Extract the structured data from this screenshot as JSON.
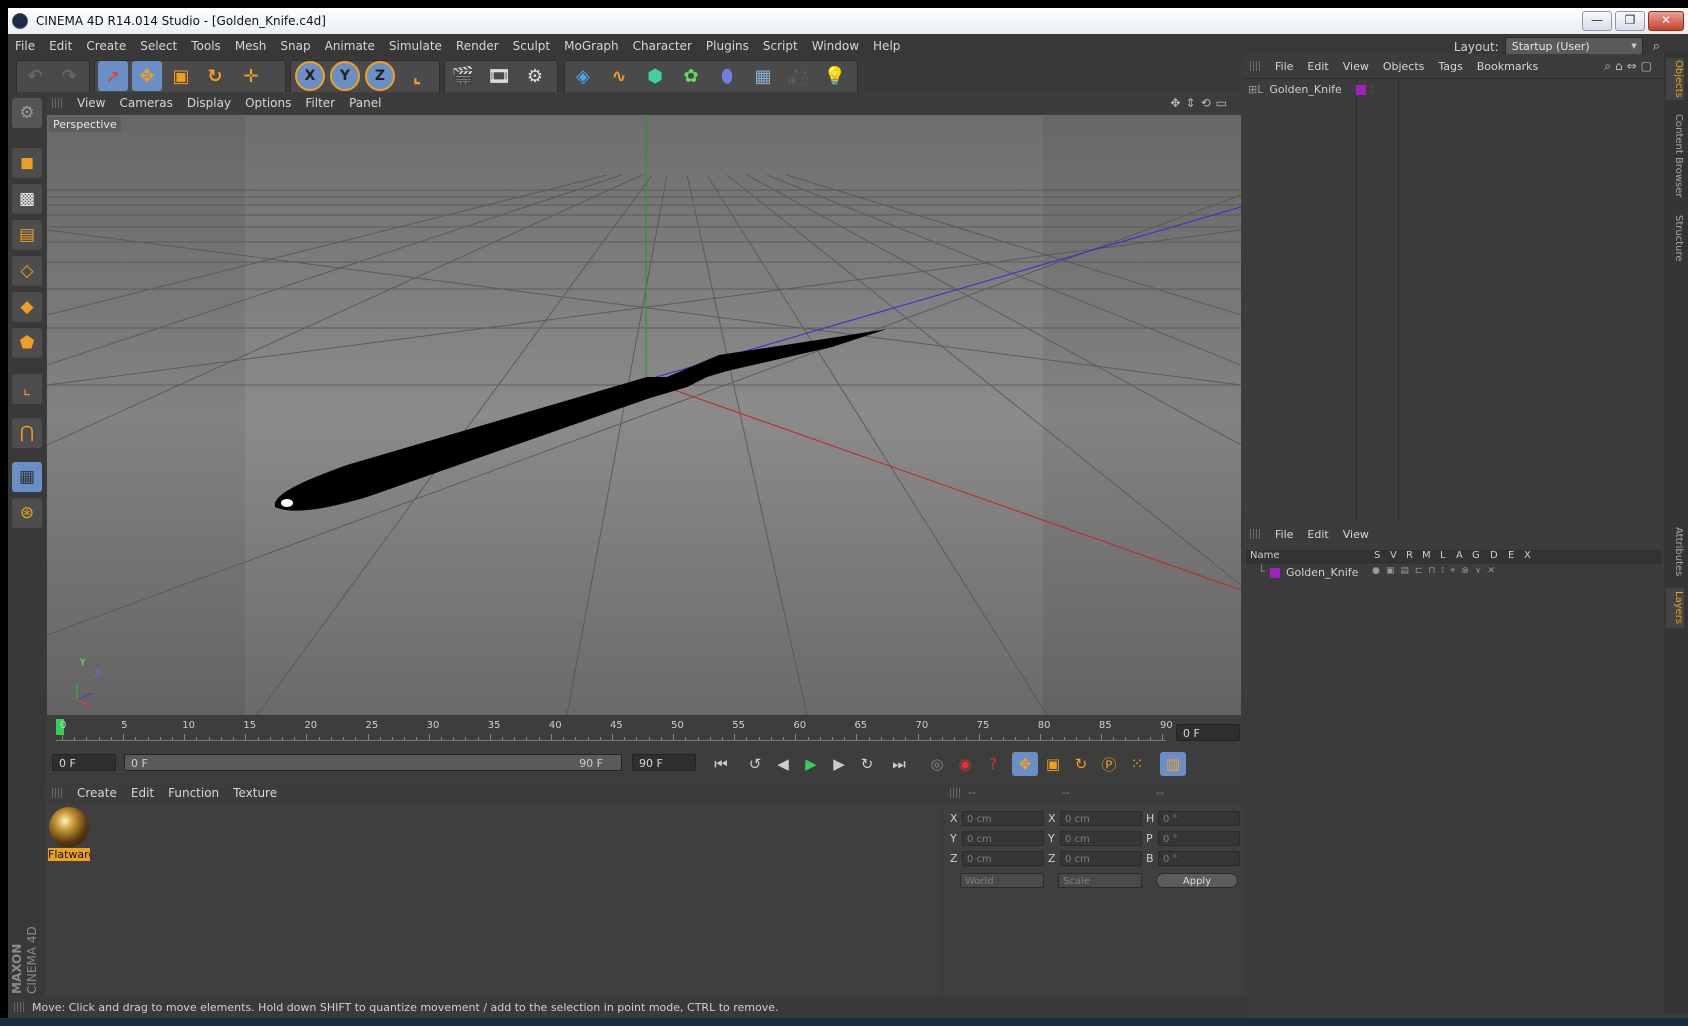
{
  "window": {
    "title": "CINEMA 4D R14.014 Studio - [Golden_Knife.c4d]",
    "minimize": "—",
    "maximize": "❐",
    "close": "✕"
  },
  "menubar": {
    "items": [
      "File",
      "Edit",
      "Create",
      "Select",
      "Tools",
      "Mesh",
      "Snap",
      "Animate",
      "Simulate",
      "Render",
      "Sculpt",
      "MoGraph",
      "Character",
      "Plugins",
      "Script",
      "Window",
      "Help"
    ],
    "layout_label": "Layout:",
    "layout_value": "Startup (User)"
  },
  "toolbar": {
    "icons": [
      "undo-icon",
      "redo-icon",
      "live-selection-icon",
      "move-icon",
      "scale-icon",
      "rotate-icon",
      "recent-tool-icon",
      "x-axis-lock-icon",
      "y-axis-lock-icon",
      "z-axis-lock-icon",
      "coordinate-system-icon",
      "render-view-icon",
      "render-picture-viewer-icon",
      "render-settings-icon",
      "cube-icon",
      "spline-icon",
      "nurbs-icon",
      "array-icon",
      "deformer-icon",
      "floor-icon",
      "camera-icon",
      "light-icon"
    ],
    "axis_x": "X",
    "axis_y": "Y",
    "axis_z": "Z"
  },
  "viewport": {
    "menu": [
      "View",
      "Cameras",
      "Display",
      "Options",
      "Filter",
      "Panel"
    ],
    "label": "Perspective",
    "axis_y": "Y",
    "axis_z": "Z"
  },
  "timeline": {
    "ticks": [
      "0",
      "5",
      "10",
      "15",
      "20",
      "25",
      "30",
      "35",
      "40",
      "45",
      "50",
      "55",
      "60",
      "65",
      "70",
      "75",
      "80",
      "85",
      "90"
    ],
    "current_frame": "0 F",
    "start_field": "0 F",
    "range_start": "0 F",
    "range_end": "90 F",
    "end_field": "90 F"
  },
  "material_manager": {
    "menu": [
      "Create",
      "Edit",
      "Function",
      "Texture"
    ],
    "materials": [
      {
        "name": "Flatware"
      }
    ]
  },
  "coordinates": {
    "headers": [
      "--",
      "--",
      "--"
    ],
    "rows": [
      {
        "l1": "X",
        "v1": "0 cm",
        "l2": "X",
        "v2": "0 cm",
        "l3": "H",
        "v3": "0 °"
      },
      {
        "l1": "Y",
        "v1": "0 cm",
        "l2": "Y",
        "v2": "0 cm",
        "l3": "P",
        "v3": "0 °"
      },
      {
        "l1": "Z",
        "v1": "0 cm",
        "l2": "Z",
        "v2": "0 cm",
        "l3": "B",
        "v3": "0 °"
      }
    ],
    "mode": "World",
    "scale": "Scale",
    "apply": "Apply"
  },
  "object_manager": {
    "menu": [
      "File",
      "Edit",
      "View",
      "Objects",
      "Tags",
      "Bookmarks"
    ],
    "objects": [
      {
        "name": "Golden_Knife",
        "color": "#a020c0"
      }
    ]
  },
  "layer_manager": {
    "menu": [
      "File",
      "Edit",
      "View"
    ],
    "columns": [
      "Name",
      "S",
      "V",
      "R",
      "M",
      "L",
      "A",
      "G",
      "D",
      "E",
      "X"
    ],
    "layers": [
      {
        "name": "Golden_Knife",
        "color": "#a020c0"
      }
    ]
  },
  "side_tabs": [
    "Objects",
    "Content Browser",
    "Structure",
    "Attributes",
    "Layers"
  ],
  "status": "Move: Click and drag to move elements. Hold down SHIFT to quantize movement / add to the selection in point mode, CTRL to remove.",
  "branding": {
    "maxon": "MAXON",
    "cinema": "CINEMA 4D"
  },
  "colors": {
    "accent_orange": "#f0a020",
    "active_blue": "#6a8fc7",
    "x_axis": "#d04040",
    "y_axis": "#30b030",
    "z_axis": "#4040d0"
  }
}
